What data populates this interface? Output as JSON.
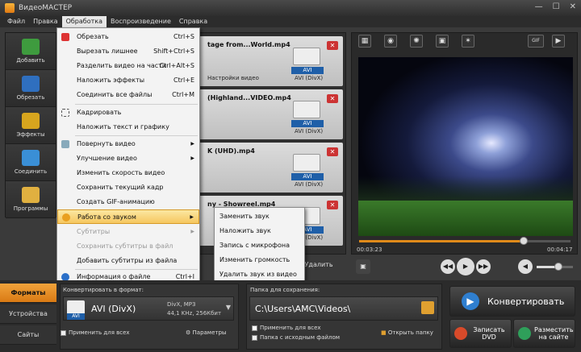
{
  "window": {
    "title": "ВидеоМАСТЕР"
  },
  "menu": [
    "Файл",
    "Правка",
    "Обработка",
    "Воспроизведение",
    "Справка"
  ],
  "sidebar": [
    {
      "label": "Добавить",
      "color": "#3e9b3e"
    },
    {
      "label": "Обрезать",
      "color": "#2f6fbf"
    },
    {
      "label": "Эффекты",
      "color": "#d7a51e"
    },
    {
      "label": "Соединить",
      "color": "#3a8fd6"
    },
    {
      "label": "Программы",
      "color": "#e0b040"
    }
  ],
  "files": [
    {
      "name": "tage from...World.mp4",
      "settings": "Настройки видео",
      "format": "AVI (DivX)",
      "badge": "AVI"
    },
    {
      "name": "(Highland...VIDEO.mp4",
      "settings": "",
      "format": "AVI (DivX)",
      "badge": "AVI"
    },
    {
      "name": "K (UHD).mp4",
      "settings": "",
      "format": "AVI (DivX)",
      "badge": "AVI"
    },
    {
      "name": "ny  -  Showreel.mp4",
      "settings": "",
      "format": "AVI (DivX)",
      "badge": "AVI"
    }
  ],
  "file_delete": "Удалить",
  "dropdown": [
    {
      "label": "Обрезать",
      "shortcut": "Ctrl+S"
    },
    {
      "label": "Вырезать лишнее",
      "shortcut": "Shift+Ctrl+S"
    },
    {
      "label": "Разделить видео на части",
      "shortcut": "Ctrl+Alt+S"
    },
    {
      "label": "Наложить эффекты",
      "shortcut": "Ctrl+E"
    },
    {
      "label": "Соединить все файлы",
      "shortcut": "Ctrl+M"
    },
    {
      "label": "Кадрировать",
      "shortcut": ""
    },
    {
      "label": "Наложить текст и графику",
      "shortcut": ""
    },
    {
      "label": "Повернуть видео",
      "shortcut": ""
    },
    {
      "label": "Улучшение видео",
      "shortcut": ""
    },
    {
      "label": "Изменить скорость видео",
      "shortcut": ""
    },
    {
      "label": "Сохранить текущий кадр",
      "shortcut": ""
    },
    {
      "label": "Создать GIF-анимацию",
      "shortcut": ""
    },
    {
      "label": "Работа со звуком",
      "shortcut": ""
    },
    {
      "label": "Субтитры",
      "shortcut": ""
    },
    {
      "label": "Сохранить субтитры в файл",
      "shortcut": ""
    },
    {
      "label": "Добавить субтитры из файла",
      "shortcut": ""
    },
    {
      "label": "Информация о файле",
      "shortcut": "Ctrl+I"
    }
  ],
  "submenu": [
    "Заменить звук",
    "Наложить звук",
    "Запись с микрофона",
    "Изменить громкость",
    "Удалить звук из видео"
  ],
  "preview": {
    "tools": [
      "▦",
      "◉",
      "✺",
      "▣",
      "✶",
      "GIF",
      "▶"
    ],
    "time_current": "00:03:23",
    "time_total": "00:04:17",
    "progress": 0.78,
    "volume": 0.6
  },
  "bottom": {
    "tabs": [
      "Форматы",
      "Устройства",
      "Сайты"
    ],
    "format_label": "Конвертировать в формат:",
    "format_name": "AVI (DivX)",
    "format_info1": "DivX, MP3",
    "format_info2": "44,1 KHz, 256Кбит",
    "format_badge": "AVI",
    "apply_all": "Применить для всех",
    "params": "Параметры",
    "folder_label": "Папка для сохранения:",
    "folder_path": "C:\\Users\\AMC\\Videos\\",
    "apply_all2": "Применить для всех",
    "source_folder": "Папка с исходным файлом",
    "open_folder": "Открыть папку",
    "convert": "Конвертировать",
    "dvd": "Записать DVD",
    "upload": "Разместить на сайте"
  }
}
